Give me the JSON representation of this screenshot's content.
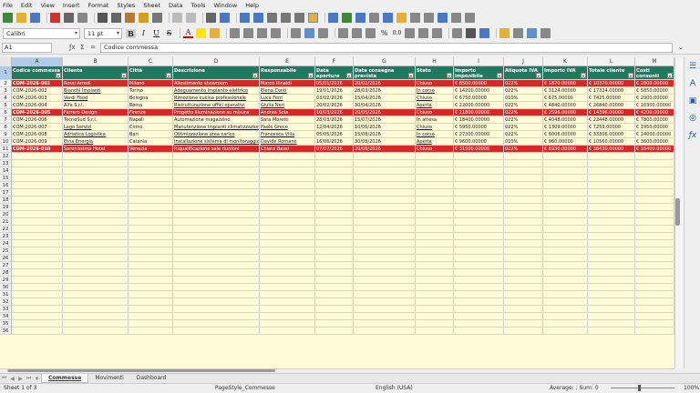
{
  "menu": [
    "File",
    "Edit",
    "View",
    "Insert",
    "Format",
    "Styles",
    "Sheet",
    "Data",
    "Tools",
    "Window",
    "Help"
  ],
  "font": {
    "name": "Calibri",
    "size": "11 pt"
  },
  "name_box": "A1",
  "formula": "Codice commessa",
  "columns": [
    "A",
    "B",
    "C",
    "D",
    "E",
    "F",
    "G",
    "H",
    "I",
    "J",
    "K",
    "L",
    "M"
  ],
  "headers": [
    "Codice commessa",
    "Cliente",
    "Città",
    "Descrizione",
    "Responsabile",
    "Data apertura",
    "Data consegna prevista",
    "Stato",
    "Importo imponibile",
    "Aliquota IVA",
    "Importo IVA",
    "Totale cliente",
    "Costi consunti"
  ],
  "rows": [
    {
      "n": "2",
      "style": "red",
      "cells": [
        "COM-2026-001",
        "Rossi Arredi",
        "Milano",
        "Allestimento showroom",
        "Marco Rinaldi",
        "05/01/2026",
        "20/02/2026",
        "Chiuso",
        "€ 8500.00000",
        "022%",
        "€ 1870.00000",
        "€ 10370.00000",
        "€ 2800.00000"
      ]
    },
    {
      "n": "3",
      "style": "yel",
      "cells": [
        "COM-2026-002",
        "Bianchi Impianti",
        "Torino",
        "Adeguamento impianto elettrico",
        "Elena Conti",
        "19/01/2026",
        "28/03/2026",
        "In corso",
        "€ 14200.00000",
        "022%",
        "€ 3124.00000",
        "€ 17324.00000",
        "€ 5850.00000"
      ]
    },
    {
      "n": "4",
      "style": "yel",
      "cells": [
        "COM-2026-003",
        "Verdi Food",
        "Bologna",
        "Rimozione cucina professionale",
        "Luca Ferri",
        "03/02/2026",
        "15/04/2026",
        "Chiuso",
        "€ 6750.00000",
        "010%",
        "€ 675.00000",
        "€ 7425.00000",
        "€ 2000.00000"
      ]
    },
    {
      "n": "5",
      "style": "yel",
      "cells": [
        "COM-2026-004",
        "Alfa S.r.l.",
        "Roma",
        "Ristrutturazione uffici operativi",
        "Giulia Neri",
        "20/02/2026",
        "30/04/2026",
        "Aperta",
        "€ 22000.00000",
        "022%",
        "€ 4840.00000",
        "€ 26840.00000",
        "€ 10300.00000"
      ]
    },
    {
      "n": "6",
      "style": "red",
      "cells": [
        "COM-2026-005",
        "Ferrero Design",
        "Firenze",
        "Progetto illuminazione su misura",
        "Andrea Sola",
        "10/03/2026",
        "20/05/2026",
        "Chiuso",
        "€ 11800.00000",
        "022%",
        "€ 2596.00000",
        "€ 14396.00000",
        "€ 4200.00000"
      ]
    },
    {
      "n": "7",
      "style": "yel",
      "cells": [
        "COM-2026-006",
        "TecnoSud S.r.l.",
        "Napoli",
        "Automazione magazzino",
        "Sara Moretti",
        "28/03/2026",
        "15/07/2026",
        "In attesa",
        "€ 18400.00000",
        "022%",
        "€ 4048.00000",
        "€ 22448.00000",
        "€ 7800.00000"
      ]
    },
    {
      "n": "8",
      "style": "yel",
      "cells": [
        "COM-2026-007",
        "Lago Servizi",
        "Como",
        "Manutenzione impianti climatizzazione",
        "Paolo Greco",
        "12/04/2026",
        "10/06/2026",
        "Chiuso",
        "€ 5950.00000",
        "022%",
        "€ 1309.00000",
        "€ 7259.00000",
        "€ 1950.00000"
      ]
    },
    {
      "n": "9",
      "style": "yel",
      "cells": [
        "COM-2026-008",
        "Adriatica Logistica",
        "Bari",
        "Ottimizzazione area carico",
        "Francesca Villa",
        "05/05/2026",
        "15/08/2026",
        "In corso",
        "€ 27300.00000",
        "022%",
        "€ 6006.00000",
        "€ 33306.00000",
        "€ 14000.00000"
      ]
    },
    {
      "n": "10",
      "style": "yel",
      "cells": [
        "COM-2026-009",
        "Etna Energia",
        "Catania",
        "Installazione sistema di monitoraggio",
        "Davide Romano",
        "16/06/2026",
        "30/08/2026",
        "Aperta",
        "€ 9600.00000",
        "010%",
        "€ 960.00000",
        "€ 10560.00000",
        "€ 3600.00000"
      ]
    },
    {
      "n": "11",
      "style": "red",
      "cells": [
        "COM-2026-010",
        "Serenissima Hotel",
        "Venezia",
        "Riqualificazione sale riunioni",
        "Chiara Bassi",
        "07/07/2026",
        "20/08/2026",
        "Chiuso",
        "€ 31500.00000",
        "022%",
        "€ 6930.00000",
        "€ 38430.00000",
        "€ 16400.00000"
      ]
    }
  ],
  "empty_rows": [
    "12",
    "13",
    "14",
    "15",
    "16",
    "17",
    "18",
    "19",
    "20",
    "21",
    "22",
    "23",
    "24",
    "25",
    "26",
    "27",
    "28",
    "29",
    "30",
    "31",
    "32",
    "33",
    "34",
    "35",
    "36"
  ],
  "tabs": [
    "Commesse",
    "Movimenti",
    "Dashboard"
  ],
  "active_tab": "Commesse",
  "status": {
    "sheet": "Sheet 1 of 3",
    "page_style": "PageStyle_Commesse",
    "language": "English (USA)",
    "summary": "Average: ; Sum: 0",
    "zoom": "100%"
  },
  "accent": {
    "header_green": "#1f7a60",
    "closed_red": "#d42a2a",
    "row_yellow": "#fffbd9"
  }
}
